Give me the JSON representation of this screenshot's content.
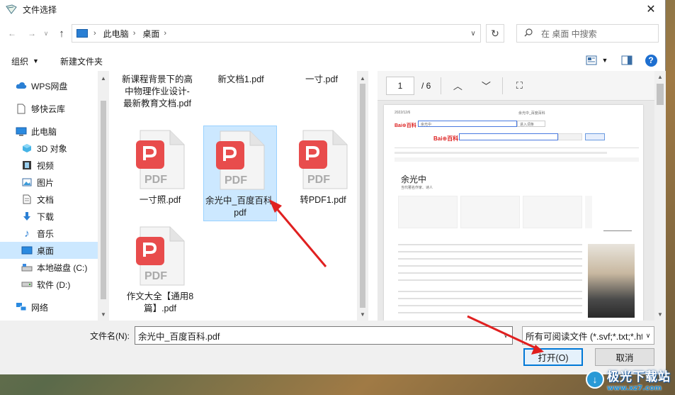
{
  "window": {
    "title": "文件选择",
    "close": "✕"
  },
  "nav": {
    "back": "←",
    "forward": "→",
    "recent": "∨",
    "up": "↑",
    "breadcrumbs": [
      "此电脑",
      "桌面"
    ],
    "refresh": "↻",
    "search_placeholder": "在 桌面 中搜索"
  },
  "toolbar": {
    "organize": "组织",
    "new_folder": "新建文件夹",
    "help": "?"
  },
  "sidebar": {
    "items": [
      {
        "label": "WPS网盘",
        "icon": "cloud-icon"
      },
      {
        "label": "够快云库",
        "icon": "document-icon"
      },
      {
        "label": "此电脑",
        "icon": "computer-icon"
      },
      {
        "label": "3D 对象",
        "icon": "cube-icon"
      },
      {
        "label": "视频",
        "icon": "video-icon"
      },
      {
        "label": "图片",
        "icon": "picture-icon"
      },
      {
        "label": "文档",
        "icon": "document-icon"
      },
      {
        "label": "下载",
        "icon": "download-icon"
      },
      {
        "label": "音乐",
        "icon": "music-icon"
      },
      {
        "label": "桌面",
        "icon": "desktop-icon",
        "selected": true
      },
      {
        "label": "本地磁盘 (C:)",
        "icon": "drive-icon"
      },
      {
        "label": "软件 (D:)",
        "icon": "drive-icon"
      },
      {
        "label": "网络",
        "icon": "network-icon"
      }
    ]
  },
  "files": {
    "items": [
      {
        "label": "新课程背景下的高中物理作业设计-最新教育文档.pdf",
        "has_icon": false
      },
      {
        "label": "新文档1.pdf",
        "has_icon": false
      },
      {
        "label": "一寸.pdf",
        "has_icon": false
      },
      {
        "label": "一寸照.pdf",
        "has_icon": true
      },
      {
        "label": "余光中_百度百科.pdf",
        "has_icon": true,
        "selected": true
      },
      {
        "label": "转PDF1.pdf",
        "has_icon": true
      },
      {
        "label": "作文大全【通用8篇】.pdf",
        "has_icon": true
      }
    ],
    "icon_text": "PDF",
    "icon_color": "#e84c4c"
  },
  "preview": {
    "page": "1",
    "total": "/ 6",
    "prev": "︿",
    "next": "﹀",
    "fit": "⛶",
    "paper": {
      "date": "2022/12/6",
      "header": "余光中_百度百科",
      "search_text": "余光中",
      "search_btn": "进入词条",
      "name": "余光中",
      "subtitle": "当代著名作家、诗人"
    }
  },
  "bottom": {
    "filename_label": "文件名(N):",
    "filename_value": "余光中_百度百科.pdf",
    "filter_value": "所有可阅读文件 (*.svf;*.txt;*.ht",
    "open_label": "打开(O)",
    "cancel_label": "取消"
  },
  "watermark": {
    "name": "极光下载站",
    "url": "www.xz7.com"
  },
  "colors": {
    "accent": "#0078d7",
    "selection": "#cce8ff",
    "pdf_red": "#e84c4c",
    "arrow_red": "#e02020"
  }
}
